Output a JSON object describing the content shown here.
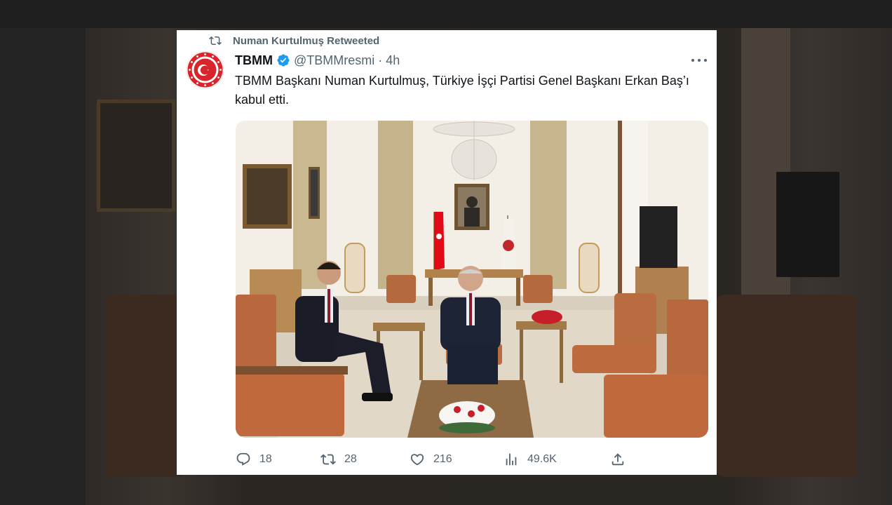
{
  "retweet": {
    "label": "Numan Kurtulmuş Retweeted",
    "icon": "retweet-icon"
  },
  "author": {
    "name": "TBMM",
    "handle": "@TBMMresmi",
    "separator": "·",
    "time": "4h",
    "verified": true,
    "avatar_icon": "tbmm-emblem",
    "verified_color": "#1d9bf0"
  },
  "tweet": {
    "text": "TBMM Başkanı Numan Kurtulmuş, Türkiye İşçi Partisi Genel Başkanı Erkan Baş’ı kabul etti."
  },
  "media": {
    "type": "photo",
    "icons": [
      "turkish-flag",
      "tbmm-flag",
      "chandelier",
      "portrait",
      "flower-arrangement"
    ]
  },
  "actions": {
    "reply_count": "18",
    "retweet_count": "28",
    "like_count": "216",
    "view_count": "49.6K"
  },
  "colors": {
    "accent": "#1d9bf0",
    "secondary_text": "#536471",
    "primary_text": "#0f1419",
    "flag_red": "#e30a17"
  }
}
